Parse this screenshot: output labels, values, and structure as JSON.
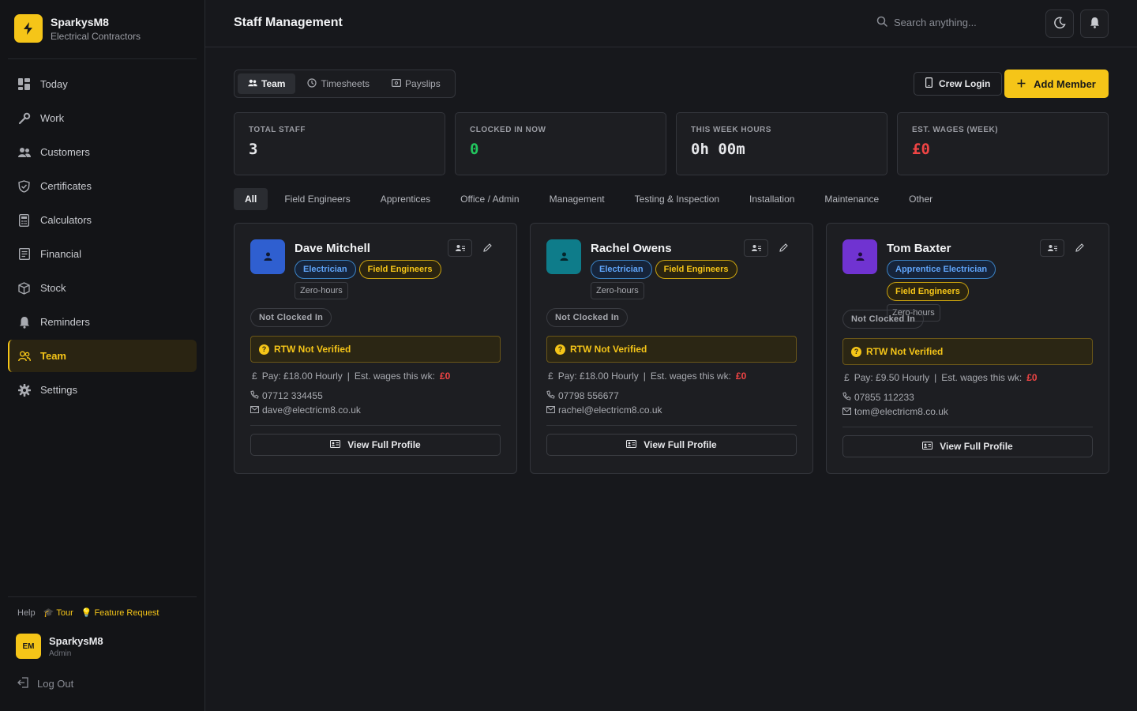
{
  "brand": {
    "name": "SparkysM8",
    "subtitle": "Electrical Contractors",
    "accent": "#f5c518"
  },
  "nav": [
    {
      "label": "Today",
      "icon": "dashboard-icon",
      "active": false
    },
    {
      "label": "Work",
      "icon": "wrench-icon",
      "active": false
    },
    {
      "label": "Customers",
      "icon": "users-icon",
      "active": false
    },
    {
      "label": "Certificates",
      "icon": "shield-icon",
      "active": false
    },
    {
      "label": "Calculators",
      "icon": "calculator-icon",
      "active": false
    },
    {
      "label": "Financial",
      "icon": "ledger-icon",
      "active": false
    },
    {
      "label": "Stock",
      "icon": "box-icon",
      "active": false
    },
    {
      "label": "Reminders",
      "icon": "bell-icon",
      "active": false
    },
    {
      "label": "Team",
      "icon": "team-icon",
      "active": true
    },
    {
      "label": "Settings",
      "icon": "gear-icon",
      "active": false
    }
  ],
  "help": {
    "help_label": "Help",
    "tour_label": "Tour",
    "feature_label": "Feature Request"
  },
  "user": {
    "initials": "EM",
    "name": "SparkysM8",
    "role": "Admin",
    "logout_label": "Log Out"
  },
  "header": {
    "title": "Staff Management",
    "search_placeholder": "Search anything..."
  },
  "tabs": [
    {
      "label": "Team",
      "active": true
    },
    {
      "label": "Timesheets",
      "active": false
    },
    {
      "label": "Payslips",
      "active": false
    }
  ],
  "actions": {
    "crew_login": "Crew Login",
    "add_member": "Add Member"
  },
  "stats": [
    {
      "label": "TOTAL STAFF",
      "value": "3",
      "color": "#e6e7ea"
    },
    {
      "label": "CLOCKED IN NOW",
      "value": "0",
      "color": "#22c55e"
    },
    {
      "label": "THIS WEEK HOURS",
      "value": "0h 00m",
      "color": "#e6e7ea"
    },
    {
      "label": "EST. WAGES (WEEK)",
      "value": "£0",
      "color": "#ef4444"
    }
  ],
  "filters": [
    "All",
    "Field Engineers",
    "Apprentices",
    "Office / Admin",
    "Management",
    "Testing & Inspection",
    "Installation",
    "Maintenance",
    "Other"
  ],
  "members": [
    {
      "name": "Dave Mitchell",
      "avatar_color": "#2f5fd0",
      "role_badge": "Electrician",
      "group_badge": "Field Engineers",
      "contract": "Zero-hours",
      "clock_status": "Not Clocked In",
      "rtw": "RTW Not Verified",
      "pay_text": "Pay: £18.00 Hourly",
      "wages_label": "Est. wages this wk:",
      "wages_value": "£0",
      "phone": "07712 334455",
      "email": "dave@electricm8.co.uk",
      "profile_label": "View Full Profile"
    },
    {
      "name": "Rachel Owens",
      "avatar_color": "#0e7c8a",
      "role_badge": "Electrician",
      "group_badge": "Field Engineers",
      "contract": "Zero-hours",
      "clock_status": "Not Clocked In",
      "rtw": "RTW Not Verified",
      "pay_text": "Pay: £18.00 Hourly",
      "wages_label": "Est. wages this wk:",
      "wages_value": "£0",
      "phone": "07798 556677",
      "email": "rachel@electricm8.co.uk",
      "profile_label": "View Full Profile"
    },
    {
      "name": "Tom Baxter",
      "avatar_color": "#7033d1",
      "role_badge": "Apprentice Electrician",
      "group_badge": "Field Engineers",
      "contract": "Zero-hours",
      "clock_status": "Not Clocked In",
      "rtw": "RTW Not Verified",
      "pay_text": "Pay: £9.50 Hourly",
      "wages_label": "Est. wages this wk:",
      "wages_value": "£0",
      "phone": "07855 112233",
      "email": "tom@electricm8.co.uk",
      "profile_label": "View Full Profile"
    }
  ]
}
